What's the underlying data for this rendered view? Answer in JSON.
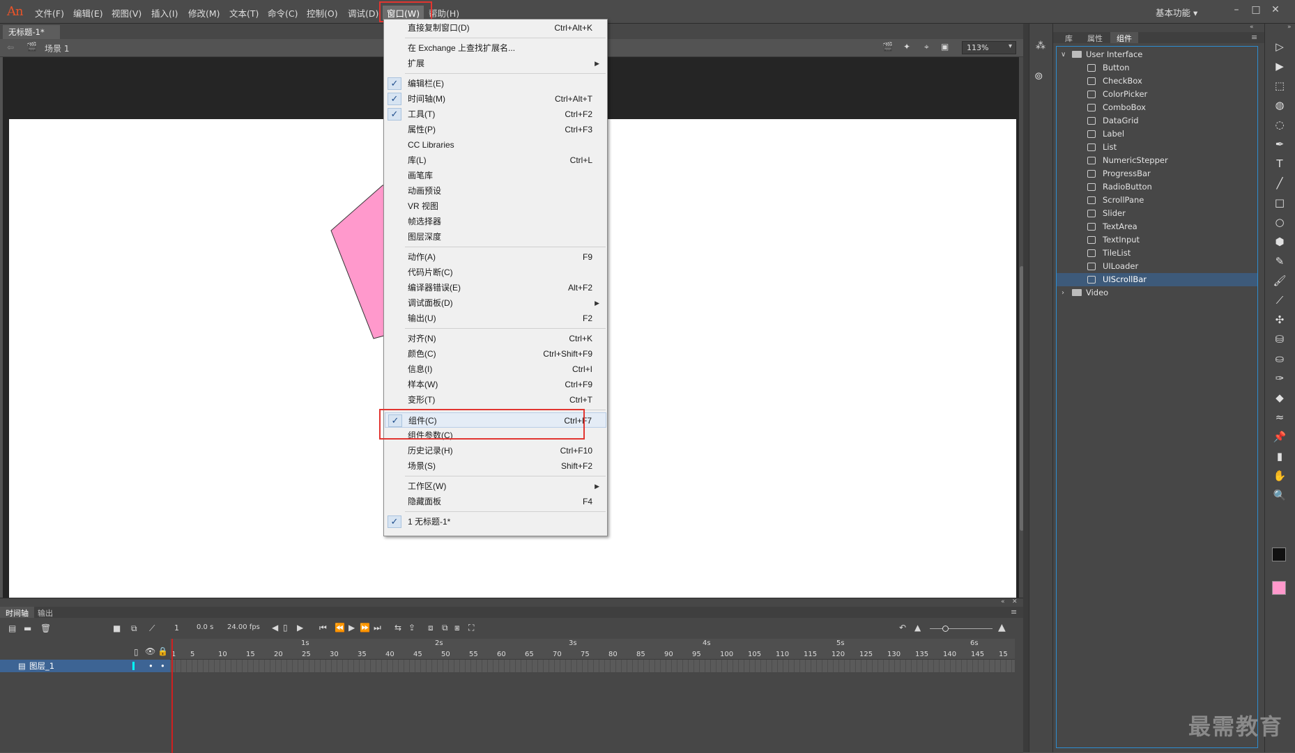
{
  "app": {
    "logo": "An"
  },
  "menubar": {
    "items": [
      "文件(F)",
      "编辑(E)",
      "视图(V)",
      "插入(I)",
      "修改(M)",
      "文本(T)",
      "命令(C)",
      "控制(O)",
      "调试(D)",
      "窗口(W)",
      "帮助(H)"
    ],
    "active": "窗口(W)",
    "workspace": "基本功能 ▾"
  },
  "document": {
    "tab": "无标题-1*",
    "scene": "场景 1",
    "zoom": "113%"
  },
  "shape_color": "#ff99cc",
  "window_menu": {
    "items": [
      {
        "label": "直接复制窗口(D)",
        "shortcut": "Ctrl+Alt+K"
      },
      {
        "label": "在 Exchange 上查找扩展名..."
      },
      {
        "label": "扩展",
        "submenu": true
      },
      {
        "label": "编辑栏(E)",
        "checked": true
      },
      {
        "label": "时间轴(M)",
        "checked": true,
        "shortcut": "Ctrl+Alt+T"
      },
      {
        "label": "工具(T)",
        "checked": true,
        "shortcut": "Ctrl+F2"
      },
      {
        "label": "属性(P)",
        "shortcut": "Ctrl+F3"
      },
      {
        "label": "CC Libraries"
      },
      {
        "label": "库(L)",
        "shortcut": "Ctrl+L"
      },
      {
        "label": "画笔库"
      },
      {
        "label": "动画预设"
      },
      {
        "label": "VR 视图"
      },
      {
        "label": "帧选择器"
      },
      {
        "label": "图层深度"
      },
      {
        "label": "动作(A)",
        "shortcut": "F9"
      },
      {
        "label": "代码片断(C)"
      },
      {
        "label": "编译器错误(E)",
        "shortcut": "Alt+F2"
      },
      {
        "label": "调试面板(D)",
        "submenu": true
      },
      {
        "label": "输出(U)",
        "shortcut": "F2"
      },
      {
        "label": "对齐(N)",
        "shortcut": "Ctrl+K"
      },
      {
        "label": "颜色(C)",
        "shortcut": "Ctrl+Shift+F9"
      },
      {
        "label": "信息(I)",
        "shortcut": "Ctrl+I"
      },
      {
        "label": "样本(W)",
        "shortcut": "Ctrl+F9"
      },
      {
        "label": "变形(T)",
        "shortcut": "Ctrl+T"
      },
      {
        "label": "组件(C)",
        "checked": true,
        "shortcut": "Ctrl+F7",
        "highlighted": true
      },
      {
        "label": "组件参数(C)"
      },
      {
        "label": "历史记录(H)",
        "shortcut": "Ctrl+F10"
      },
      {
        "label": "场景(S)",
        "shortcut": "Shift+F2"
      },
      {
        "label": "工作区(W)",
        "submenu": true
      },
      {
        "label": "隐藏面板",
        "shortcut": "F4"
      },
      {
        "label": "1 无标题-1*",
        "checked": true
      }
    ]
  },
  "panel": {
    "tabs": [
      "库",
      "属性",
      "组件"
    ],
    "active_tab": "组件",
    "folder_ui": "User Interface",
    "folder_video": "Video",
    "components": [
      "Button",
      "CheckBox",
      "ColorPicker",
      "ComboBox",
      "DataGrid",
      "Label",
      "List",
      "NumericStepper",
      "ProgressBar",
      "RadioButton",
      "ScrollPane",
      "Slider",
      "TextArea",
      "TextInput",
      "TileList",
      "UILoader",
      "UIScrollBar"
    ],
    "selected": "UIScrollBar"
  },
  "timeline": {
    "tabs": [
      "时间轴",
      "输出"
    ],
    "frame": "1",
    "time": "0.0 s",
    "fps": "24.00 fps",
    "layer": "图层_1",
    "seconds": [
      "1s",
      "2s",
      "3s",
      "4s",
      "5s",
      "6s"
    ],
    "ticks": [
      "1",
      "5",
      "10",
      "15",
      "20",
      "25",
      "30",
      "35",
      "40",
      "45",
      "50",
      "55",
      "60",
      "65",
      "70",
      "75",
      "80",
      "85",
      "90",
      "95",
      "100",
      "105",
      "110",
      "115",
      "120",
      "125",
      "130",
      "135",
      "140",
      "145",
      "15"
    ]
  },
  "watermark": "最需教育"
}
